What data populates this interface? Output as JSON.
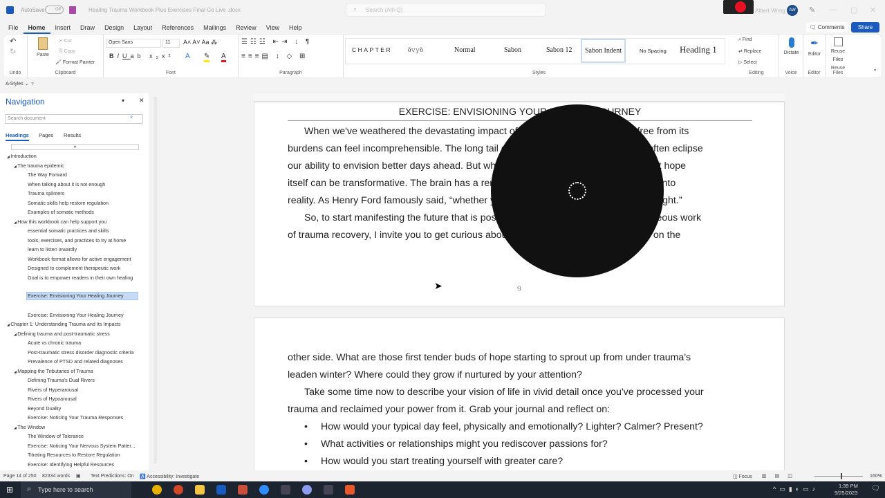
{
  "titlebar": {
    "autosave": "AutoSave",
    "autosave_state": "Off",
    "filename": "Healing Trauma Workbook Plus Exercises Final Go Live .docx",
    "search_placeholder": "Search (Alt+Q)",
    "user": "Albert Wong",
    "avatar": "AW"
  },
  "tabs": [
    "File",
    "Home",
    "Insert",
    "Draw",
    "Design",
    "Layout",
    "References",
    "Mailings",
    "Review",
    "View",
    "Help"
  ],
  "actions": {
    "comments": "Comments",
    "share": "Share"
  },
  "ribbon": {
    "undo": "Undo",
    "clipboard": {
      "label": "Clipboard",
      "paste": "Paste",
      "cut": "Cut",
      "copy": "Copy",
      "format_painter": "Format Painter"
    },
    "font": {
      "label": "Font",
      "name": "Open Sans",
      "size": "11"
    },
    "paragraph": "Paragraph",
    "styles": {
      "label": "Styles",
      "items": [
        "CHAPTER",
        "ὃ𝚟𝚢ὃ",
        "Normal",
        "Sabon",
        "Sabon 12",
        "Sabon Indent",
        "No Spacing",
        "Heading 1"
      ]
    },
    "editing": {
      "label": "Editing",
      "find": "Find",
      "replace": "Replace",
      "select": "Select"
    },
    "voice": {
      "label": "Voice",
      "dictate": "Dictate"
    },
    "editor": {
      "label": "Editor",
      "editor": "Editor"
    },
    "reuse": {
      "label": "Reuse Files",
      "button": "Reuse Files"
    },
    "styles_pane": "Styles"
  },
  "nav": {
    "title": "Navigation",
    "search_placeholder": "Search document",
    "tabs": [
      "Headings",
      "Pages",
      "Results"
    ],
    "items": [
      {
        "t": "Introduction",
        "l": 0
      },
      {
        "t": "The trauma epidemic",
        "l": 1
      },
      {
        "t": "The Way Forward",
        "l": 2
      },
      {
        "t": "When talking about it is not enough",
        "l": 2
      },
      {
        "t": "Trauma splinters",
        "l": 2
      },
      {
        "t": "Somatic skills help restore regulation",
        "l": 2
      },
      {
        "t": "Examples of somatic methods",
        "l": 2
      },
      {
        "t": "How this workbook can help support you",
        "l": 1
      },
      {
        "t": "essential somatic practices and skills",
        "l": 2
      },
      {
        "t": "tools, exercises, and practices to try at home",
        "l": 2
      },
      {
        "t": "learn to listen inwardly",
        "l": 2
      },
      {
        "t": "Workbook format allows for active engagement",
        "l": 2
      },
      {
        "t": "Designed to complement therapeutic work",
        "l": 2
      },
      {
        "t": "Goal is to empower readers in their own healing",
        "l": 2
      },
      {
        "t": "",
        "l": 2
      },
      {
        "t": "Exercise: Envisioning Your Healing Journey",
        "l": 2,
        "sel": true
      },
      {
        "t": "",
        "l": 2
      },
      {
        "t": "Exercise: Envisioning Your Healing Journey",
        "l": 2
      },
      {
        "t": "Chapter 1: Understanding Trauma and Its Impacts",
        "l": 0
      },
      {
        "t": "Defining trauma and post-traumatic stress",
        "l": 1
      },
      {
        "t": "Acute vs chronic trauma",
        "l": 2
      },
      {
        "t": "Post-traumatic stress disorder diagnostic criteria",
        "l": 2
      },
      {
        "t": "Prevalence of PTSD and related diagnoses",
        "l": 2
      },
      {
        "t": "Mapping the Tributaries of Trauma",
        "l": 1
      },
      {
        "t": "Defining Trauma's Dual Rivers",
        "l": 2
      },
      {
        "t": "Rivers of Hyperarousal",
        "l": 2
      },
      {
        "t": "Rivers of Hypoarousal",
        "l": 2
      },
      {
        "t": "Beyond Duality",
        "l": 2
      },
      {
        "t": "Exercise:  Noticing Your Trauma Responses",
        "l": 2
      },
      {
        "t": "The Window",
        "l": 1
      },
      {
        "t": "The Window of Tolerance",
        "l": 2
      },
      {
        "t": "Exercise:  Noticing Your Nervous System Patter...",
        "l": 2
      },
      {
        "t": "Titrating Resources to Restore Regulation",
        "l": 2
      },
      {
        "t": "Exercise:  Identifying Helpful Resources",
        "l": 2
      }
    ]
  },
  "document": {
    "heading": "EXERCISE: ENVISIONING YOUR HEALING JOURNEY",
    "page1_lines": [
      "When we've weathered the devastating impact of trauma, imagining a future free from its",
      "burdens can feel incomprehensible. The long tail of pain, fear, shame and isolation often eclipse",
      "our ability to envision better days ahead. But what I've learned over many years is that hope",
      "itself can be transformative. The brain has a remarkable capacity to turn expectations into",
      "reality. As Henry Ford famously said, “whether you think you can, or you can't, you're right.”",
      "So, to start manifesting the future that is possible for you when you do the courageous work",
      "of trauma recovery, I invite you to get curious about what life could look and feel like on the"
    ],
    "page_number": "9",
    "page2_lines": [
      "other side. What are those first tender buds of hope starting to sprout up from under trauma's",
      "leaden winter? Where could they grow if nurtured by your attention?",
      "Take some time now to describe your vision of life in vivid detail once you've processed your",
      "trauma and reclaimed your power from it. Grab your journal and reflect on:"
    ],
    "bullets": [
      "How would your typical day feel, physically and emotionally? Lighter? Calmer? Present?",
      "What activities or relationships might you rediscover passions for?",
      "How would you start treating yourself with greater care?"
    ]
  },
  "status": {
    "page": "Page 14 of 250",
    "words": "82334 words",
    "predictions": "Text Predictions: On",
    "accessibility": "Accessibility: Investigate",
    "focus": "Focus",
    "zoom": "160%"
  },
  "taskbar": {
    "search_placeholder": "Type here to search",
    "time": "1:39 PM",
    "date": "9/25/2023"
  },
  "colors": {
    "accent": "#185abd",
    "share": "#185abd",
    "record": "#e81123"
  }
}
